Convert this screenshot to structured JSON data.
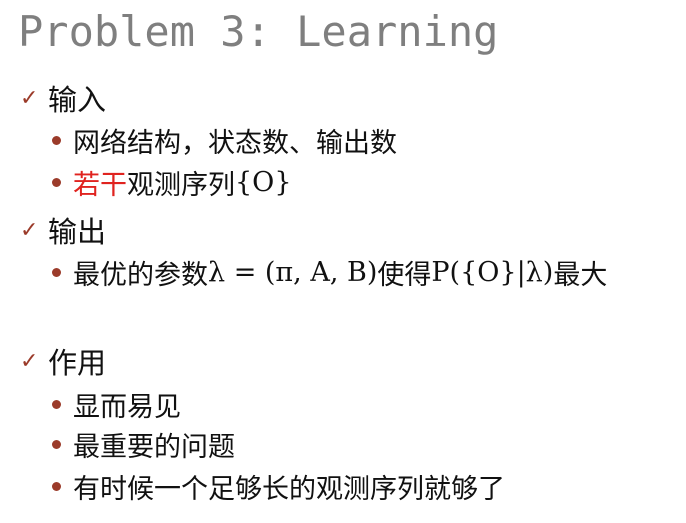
{
  "title": "Problem 3: Learning",
  "colors": {
    "title": "#7f7f7f",
    "bullet": "#9b3b2a",
    "accent": "#e0231f",
    "text": "#111111"
  },
  "sections": [
    {
      "heading": "输入",
      "bullet_icon": "check-mark-icon",
      "items": [
        {
          "text": "网络结构，状态数、输出数"
        },
        {
          "highlight": "若干",
          "text": "观测序列",
          "math_text": "{O}"
        }
      ]
    },
    {
      "heading": "输出",
      "bullet_icon": "check-mark-icon",
      "items": [
        {
          "text_before": "最优的参数",
          "math_1": "λ = (π, A, B)",
          "text_middle": "使得",
          "math_2": "P({O}|λ)",
          "text_after": "最大"
        }
      ]
    },
    {
      "heading": "作用",
      "bullet_icon": "check-mark-icon",
      "items": [
        {
          "text": "显而易见"
        },
        {
          "text": "最重要的问题"
        },
        {
          "text": "有时候一个足够长的观测序列就够了"
        }
      ]
    }
  ]
}
